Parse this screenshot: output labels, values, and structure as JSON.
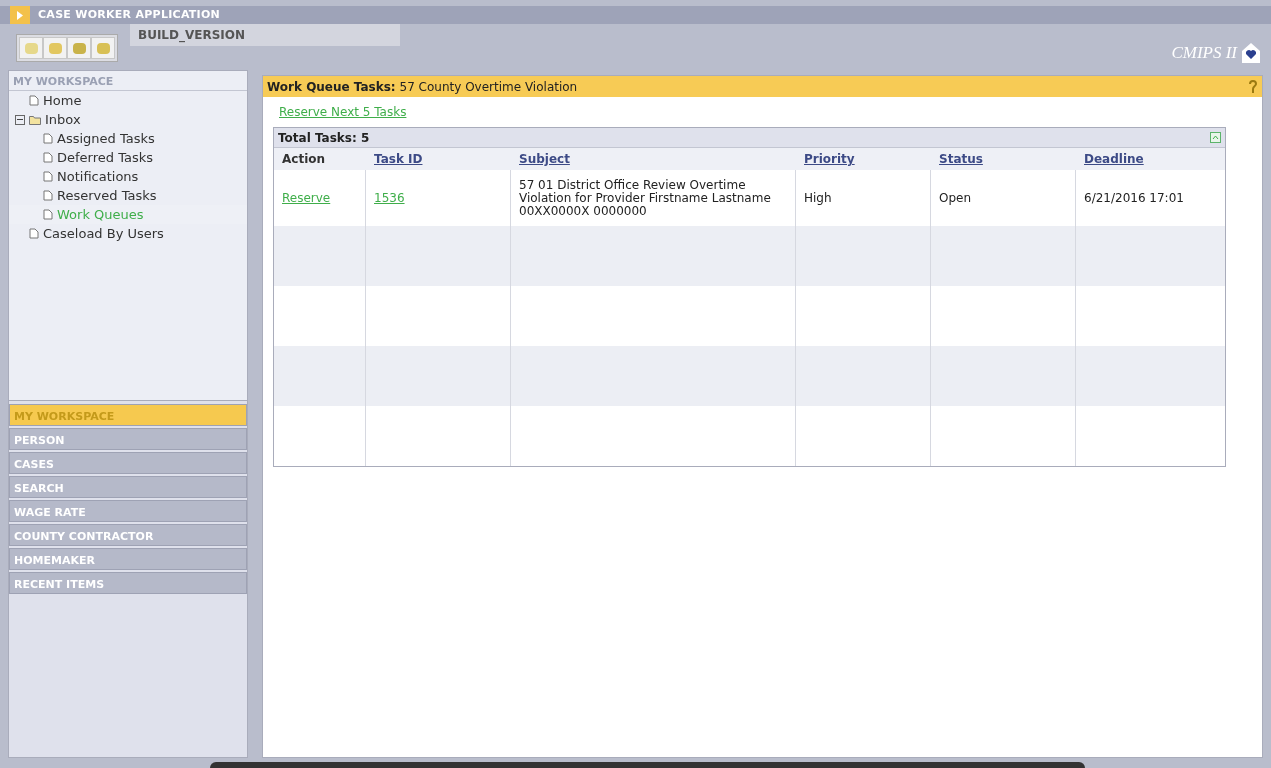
{
  "app_title": "CASE WORKER APPLICATION",
  "build_label": "BUILD_VERSION",
  "logo": "CMIPS II",
  "workspace": {
    "title": "MY WORKSPACE",
    "tree": [
      {
        "label": "Home",
        "selected": false
      },
      {
        "label": "Inbox",
        "selected": false,
        "expanded": true,
        "children": [
          {
            "label": "Assigned Tasks",
            "selected": false
          },
          {
            "label": "Deferred Tasks",
            "selected": false
          },
          {
            "label": "Notifications",
            "selected": false
          },
          {
            "label": "Reserved Tasks",
            "selected": false
          },
          {
            "label": "Work Queues",
            "selected": true
          }
        ]
      },
      {
        "label": "Caseload By Users",
        "selected": false
      }
    ]
  },
  "nav": [
    {
      "label": "MY WORKSPACE",
      "selected": true
    },
    {
      "label": "PERSON",
      "selected": false
    },
    {
      "label": "CASES",
      "selected": false
    },
    {
      "label": "SEARCH",
      "selected": false
    },
    {
      "label": "WAGE RATE",
      "selected": false
    },
    {
      "label": "COUNTY CONTRACTOR",
      "selected": false
    },
    {
      "label": "HOMEMAKER",
      "selected": false
    },
    {
      "label": "RECENT ITEMS",
      "selected": false
    }
  ],
  "page": {
    "title_label": "Work Queue Tasks:",
    "title_value": "57 County Overtime Violation",
    "action_link": "Reserve Next 5 Tasks"
  },
  "table": {
    "caption": "Total Tasks: 5",
    "columns": [
      {
        "label": "Action",
        "sortable": false
      },
      {
        "label": "Task ID",
        "sortable": true
      },
      {
        "label": "Subject",
        "sortable": true
      },
      {
        "label": "Priority",
        "sortable": true
      },
      {
        "label": "Status",
        "sortable": true
      },
      {
        "label": "Deadline",
        "sortable": true
      }
    ],
    "rows": [
      {
        "action": "Reserve",
        "task_id": "1536",
        "subject": "57 01 District Office Review Overtime Violation for Provider Firstname Lastname 00XX0000X 0000000",
        "priority": "High",
        "status": "Open",
        "deadline": "6/21/2016 17:01"
      }
    ]
  }
}
